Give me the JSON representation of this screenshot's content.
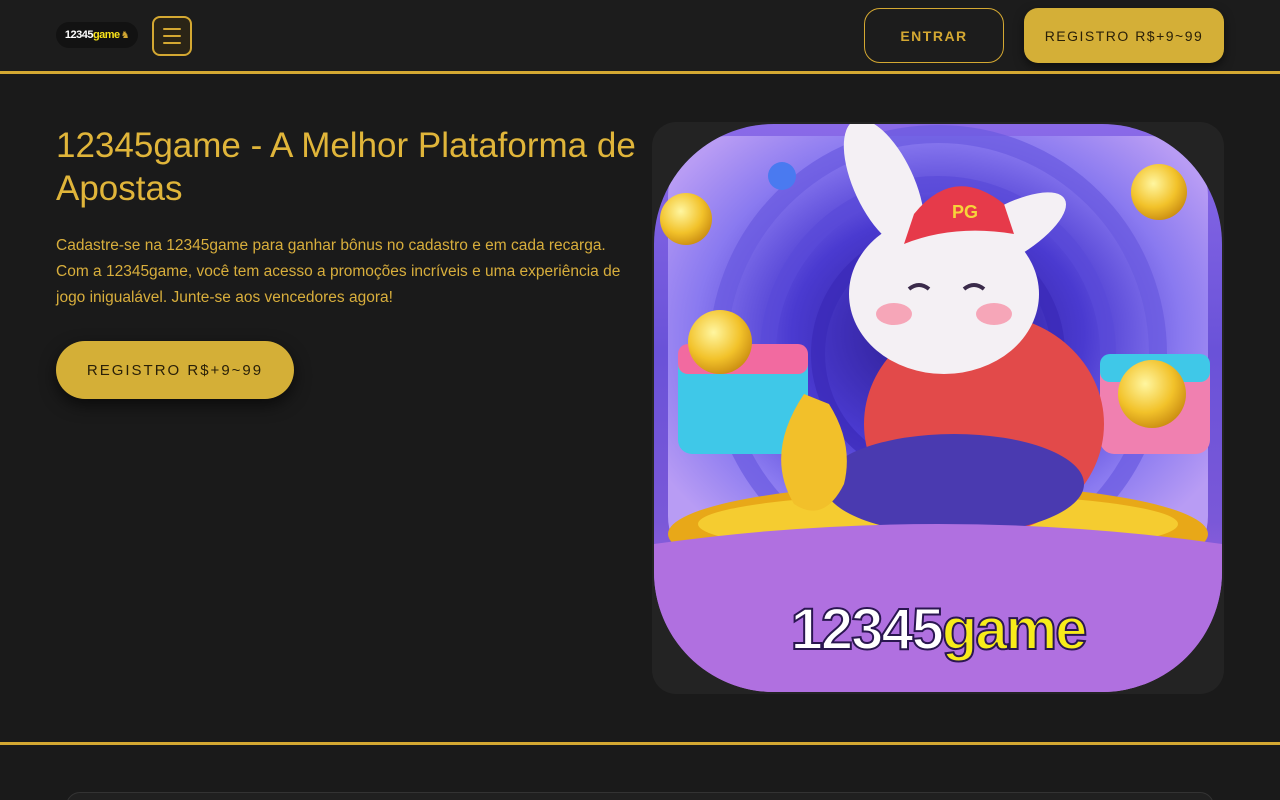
{
  "header": {
    "logo": {
      "part1": "12345",
      "part2": "game"
    },
    "entrar_label": "ENTRAR",
    "registro_label": "REGISTRO R$+9~99"
  },
  "hero": {
    "title": "12345game - A Melhor Plataforma de Apostas",
    "description": "Cadastre-se na 12345game para ganhar bônus no cadastro e em cada recarga. Com a 12345game, você tem acesso a promoções incríveis e uma experiência de jogo inigualável. Junte-se aos vencedores agora!",
    "cta_label": "REGISTRO R$+9~99",
    "image": {
      "cap_text": "PG",
      "brand_part1": "12345",
      "brand_part2": "game"
    }
  },
  "colors": {
    "accent": "#d4af37",
    "background": "#1a1a1a",
    "text": "#e0b53a"
  }
}
